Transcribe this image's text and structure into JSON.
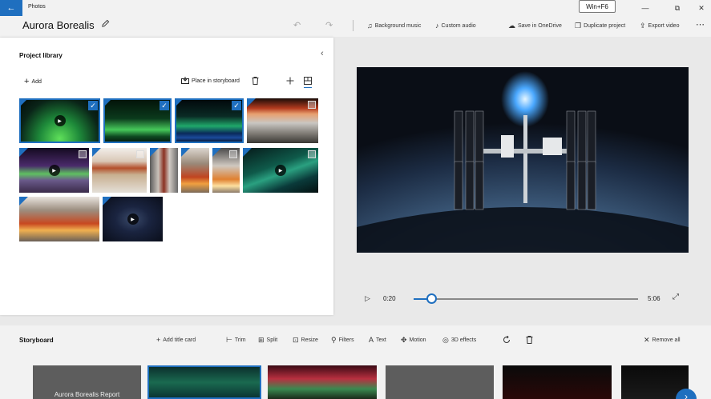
{
  "window": {
    "app_title": "Photos",
    "back_glyph": "←",
    "badge_text": "Win+F6",
    "controls": [
      "—",
      "⧉",
      "✕"
    ]
  },
  "header": {
    "project_title": "Aurora Borealis",
    "edit_icon": "pencil-icon",
    "undo_glyph": "↶",
    "redo_glyph": "↷",
    "buttons": [
      {
        "label": "Background music",
        "icon": "♫"
      },
      {
        "label": "Custom audio",
        "icon": "♪"
      },
      {
        "label": "Save in OneDrive",
        "icon": "☁"
      },
      {
        "label": "Duplicate project",
        "icon": "❐"
      },
      {
        "label": "Export video",
        "icon": "⇪"
      }
    ],
    "more_glyph": "⋯"
  },
  "library": {
    "title": "Project library",
    "collapse_glyph": "‹",
    "add_label": "Add",
    "place_label": "Place in storyboard",
    "delete_icon": "trash-icon",
    "thumbnails": [
      {
        "id": "t1",
        "selected": true,
        "video": true
      },
      {
        "id": "t2",
        "selected": true,
        "video": false
      },
      {
        "id": "t3",
        "selected": true,
        "video": false
      },
      {
        "id": "t4",
        "selected": false,
        "video": false
      },
      {
        "id": "t5",
        "selected": false,
        "video": true
      },
      {
        "id": "t6",
        "selected": false,
        "video": false
      },
      {
        "id": "t7",
        "selected": false,
        "video": false
      },
      {
        "id": "t8",
        "selected": false,
        "video": false
      },
      {
        "id": "t9",
        "selected": false,
        "video": false
      },
      {
        "id": "t10",
        "selected": false,
        "video": true
      },
      {
        "id": "t11",
        "selected": false,
        "video": false
      },
      {
        "id": "t12",
        "selected": false,
        "video": false
      },
      {
        "id": "t13",
        "selected": false,
        "video": true
      }
    ]
  },
  "player": {
    "play_glyph": "▷",
    "current_time": "0:20",
    "end_time": "5:06",
    "progress": 0.08,
    "fullscreen_glyph": "⤢"
  },
  "storyboard": {
    "title": "Storyboard",
    "tools": [
      {
        "label": "Add title card",
        "icon": "+"
      },
      {
        "label": "Trim",
        "icon": "⊢"
      },
      {
        "label": "Split",
        "icon": "⊞"
      },
      {
        "label": "Resize",
        "icon": "⊡"
      },
      {
        "label": "Filters",
        "icon": "⚲"
      },
      {
        "label": "Text",
        "icon": "A"
      },
      {
        "label": "Motion",
        "icon": "✥"
      },
      {
        "label": "3D effects",
        "icon": "◎"
      }
    ],
    "rotate_icon": "rotate-icon",
    "delete_icon": "trash-icon",
    "remove_all_label": "Remove all",
    "remove_all_icon": "✕",
    "cards": [
      {
        "label": "Aurora Borealis Report"
      },
      {
        "label": ""
      },
      {
        "label": ""
      },
      {
        "label": ""
      },
      {
        "label": ""
      },
      {
        "label": ""
      }
    ],
    "next_glyph": "›"
  },
  "colors": {
    "accent": "#1f6fbf",
    "panel": "#ffffff",
    "chrome": "#f2f2f2"
  }
}
